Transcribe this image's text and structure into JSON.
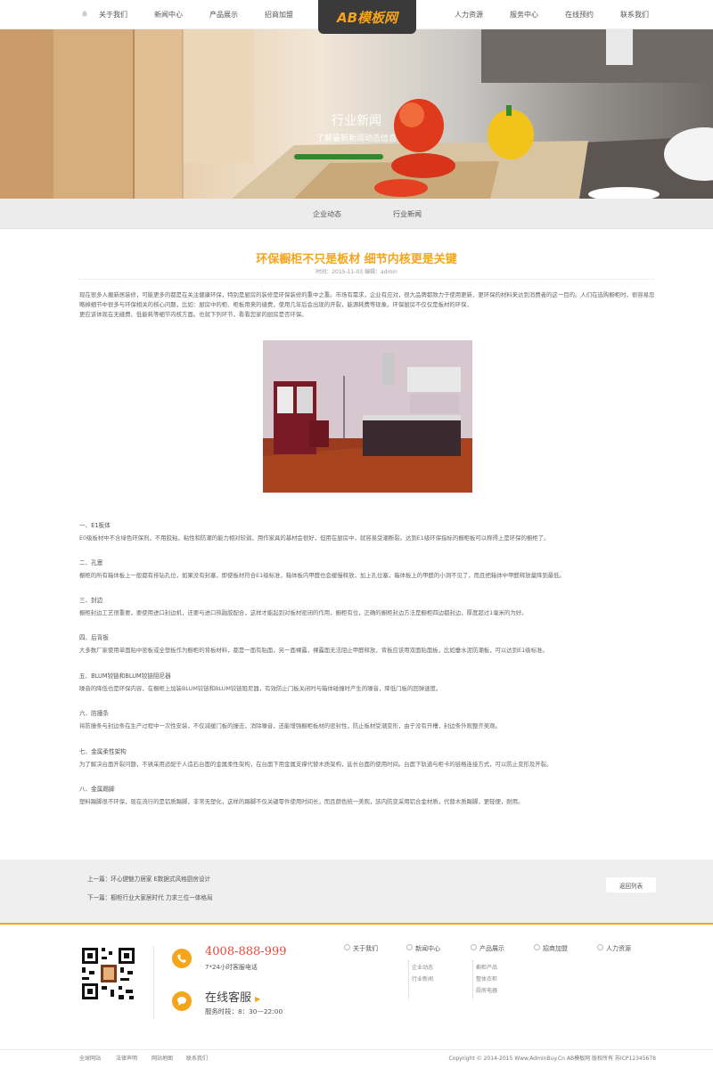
{
  "nav": {
    "left": [
      "关于我们",
      "新闻中心",
      "产品展示",
      "招商加盟"
    ],
    "logo": "AB模板网",
    "right": [
      "人力资源",
      "服务中心",
      "在线预约",
      "联系我们"
    ]
  },
  "banner": {
    "title": "行业新闻",
    "subtitle": "了解最新新闻动态信息"
  },
  "subnav": [
    "企业动态",
    "行业新闻"
  ],
  "article": {
    "title": "环保橱柜不只是板材 细节内核更是关键",
    "meta": "时间：2015-11-03    编辑：admin",
    "intro": [
      "现在很多人搬新居装修，可能更多的都是在关注健康环保，特别是厨房的装修是环保装修的重中之重。市场有需求，企业有应对，很大品牌都致力于使用更新、更环保的材料来达到消费者的这一目的。人们在选购橱柜时，很容易忽略掉细节中很多与环保相关的核心问题，比如：厨房中的柜、柜板用来的缝费，使用几年后会出现的开裂，能源耗费等现象。环保厨房不仅仅是板材的环保，",
      "更应该体现在无缝费、低能耗等细节内核方面。也就下列环节，看看您家的厨房是否环保。"
    ],
    "sections": [
      {
        "title": "一、E1板体",
        "text": "E0级板材中不含绿色环保剂，不用胶粘，粘性和防潮的能力相对较弱，用作家具的基材会很好，但用在厨房中，就容易受潮断裂。达到E1级环保指标的橱柜板可以称得上是环保的橱柜了。"
      },
      {
        "title": "二、孔塞",
        "text": "橱柜的所有箱体板上一般都有排钻孔位，如果没有封塞，即使板材符合E1级标准，箱体板内甲醛也会缓慢释放，加上孔位塞，箱体板上的甲醛的小洞不见了，而且把箱体中甲醛释放量降到最低。"
      },
      {
        "title": "三、封边",
        "text": "橱柜封边工艺很重要，要使用进口封边机，还要与进口热融胶配合，这样才能起到对板材密闭的作用，橱柜有位，正确的橱柜封边方法是橱柜四边都封边，厚度超过1毫米的为好。"
      },
      {
        "title": "四、后背板",
        "text": "大多数厂家使用单面贴中密板或全塑板作为橱柜的背板材料，都是一面有贴面，另一面裸露，裸露面无法阻止甲醛释放，背板应该用双面贴面板，比如垂水泥防潮板，可以达到E1级标准。"
      },
      {
        "title": "五、BLUM铰链和BLUM铰链阻尼器",
        "text": "噪音的降低也是环保内容，在橱柜上加装BLUM铰链和BLUM铰链阻尼器，有效防止门板关闭时与箱体碰撞时产生的噪音，降低门板的回弹速度。"
      },
      {
        "title": "六、防撞条",
        "text": "将防撞条与封边条在生产过程中一次性安装，不仅减缓门板的撞击，消除噪音，还能增强橱柜板材的密封性，防止板材受潮变形，由于没有开槽，封边条外观整齐美观。"
      },
      {
        "title": "七、金属柔性架构",
        "text": "为了解决台面开裂问题，不锈采用适配于人造石台面的金属柔性架构，在台面下用金属支撑代替木质架构，延长台面的使用时间。台面下轨道与柜卡的链格连接方式，可以防止变形及开裂。"
      },
      {
        "title": "八、金属踢脚",
        "text": "塑料踢脚很不环保，现在流行的是铝质踢脚，非常无塑化，这样的踢脚不仅关键零件使用时间长，而且颜色统一美观，該内防变采用铝合金材质，代替木质踢脚，更轻便，耐用。"
      }
    ]
  },
  "pager": {
    "prev": "上一篇：环心健魅力居家 E数据式风格厨房设计",
    "next": "下一篇：橱柜行业大家居时代 力求三位一体格局",
    "back": "返回列表"
  },
  "footer": {
    "phone": "4008-888-999",
    "phone_sub": "7*24小时客服电话",
    "cs_title": "在线客服",
    "cs_hours": "服务时段：8：30—22:00",
    "columns": [
      {
        "title": "关于我们",
        "items": []
      },
      {
        "title": "新闻中心",
        "items": [
          "企业动态",
          "行业新闻"
        ]
      },
      {
        "title": "产品展示",
        "items": [
          "橱柜产品",
          "整体衣柜",
          "厨房电器"
        ]
      },
      {
        "title": "招商加盟",
        "items": []
      },
      {
        "title": "人力资源",
        "items": []
      }
    ],
    "bottom_links": [
      "全球网站",
      "法律声明",
      "网站地图",
      "联系我们"
    ],
    "copyright": "Copyright © 2014-2015 Www.AdminBuy.Cn AB模板网 版权所有 苏ICP12345678"
  },
  "colors": {
    "accent": "#f4a51c",
    "phone": "#e5483c",
    "logo_bg": "#3a3a3a"
  }
}
